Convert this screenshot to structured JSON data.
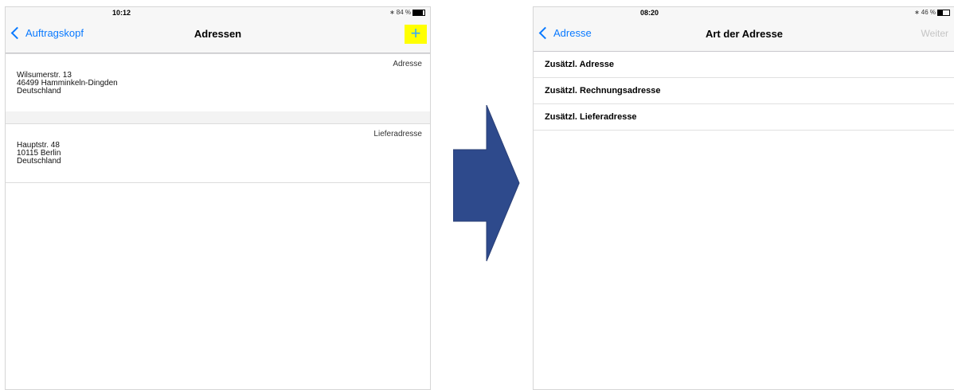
{
  "left_screen": {
    "status": {
      "time": "10:12",
      "battery_text": "84 %",
      "battery_level": 0.84
    },
    "nav": {
      "back_label": "Auftragskopf",
      "title": "Adressen",
      "add_label": "+"
    },
    "addresses": [
      {
        "type": "Adresse",
        "line1": "Wilsumerstr. 13",
        "line2": "46499 Hamminkeln-Dingden",
        "line3": "Deutschland"
      },
      {
        "type": "Lieferadresse",
        "line1": "Hauptstr. 48",
        "line2": "10115 Berlin",
        "line3": "Deutschland"
      }
    ]
  },
  "arrow": {
    "color": "#2e4a8c"
  },
  "right_screen": {
    "status": {
      "time": "08:20",
      "battery_text": "46 %",
      "battery_level": 0.46
    },
    "nav": {
      "back_label": "Adresse",
      "title": "Art der Adresse",
      "next_label": "Weiter"
    },
    "options": [
      "Zusätzl. Adresse",
      "Zusätzl. Rechnungsadresse",
      "Zusätzl. Lieferadresse"
    ]
  }
}
